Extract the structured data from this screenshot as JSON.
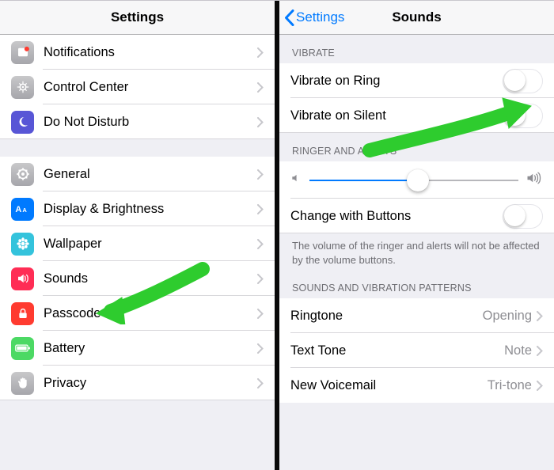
{
  "left": {
    "title": "Settings",
    "groups": [
      {
        "items": [
          {
            "key": "notifications",
            "label": "Notifications",
            "icon": "notifications",
            "color": "#b4b4b6",
            "shadow": true
          },
          {
            "key": "controlcenter",
            "label": "Control Center",
            "icon": "controlcenter",
            "color": "#b4b4b6",
            "shadow": true
          },
          {
            "key": "dnd",
            "label": "Do Not Disturb",
            "icon": "moon",
            "color": "#5856d6"
          }
        ]
      },
      {
        "items": [
          {
            "key": "general",
            "label": "General",
            "icon": "gear",
            "color": "#b4b4b6",
            "shadow": true
          },
          {
            "key": "display",
            "label": "Display & Brightness",
            "icon": "aa",
            "color": "#007aff"
          },
          {
            "key": "wallpaper",
            "label": "Wallpaper",
            "icon": "flower",
            "color": "#3ec6e0"
          },
          {
            "key": "sounds",
            "label": "Sounds",
            "icon": "speaker",
            "color": "#ff2d55"
          },
          {
            "key": "passcode",
            "label": "Passcode",
            "icon": "lock",
            "color": "#ff3b30"
          },
          {
            "key": "battery",
            "label": "Battery",
            "icon": "battery",
            "color": "#4cd964"
          },
          {
            "key": "privacy",
            "label": "Privacy",
            "icon": "hand",
            "color": "#b4b4b6",
            "shadow": true
          }
        ]
      }
    ]
  },
  "right": {
    "back": "Settings",
    "title": "Sounds",
    "vibrate_header": "VIBRATE",
    "vibrate_ring_label": "Vibrate on Ring",
    "vibrate_ring_on": false,
    "vibrate_silent_label": "Vibrate on Silent",
    "vibrate_silent_on": false,
    "ringer_header": "RINGER AND ALERTS",
    "slider_value": 0.52,
    "change_buttons_label": "Change with Buttons",
    "change_buttons_on": false,
    "ringer_footer": "The volume of the ringer and alerts will not be affected by the volume buttons.",
    "patterns_header": "SOUNDS AND VIBRATION PATTERNS",
    "ringtone_label": "Ringtone",
    "ringtone_value": "Opening",
    "texttone_label": "Text Tone",
    "texttone_value": "Note",
    "voicemail_label": "New Voicemail",
    "voicemail_value": "Tri-tone"
  }
}
